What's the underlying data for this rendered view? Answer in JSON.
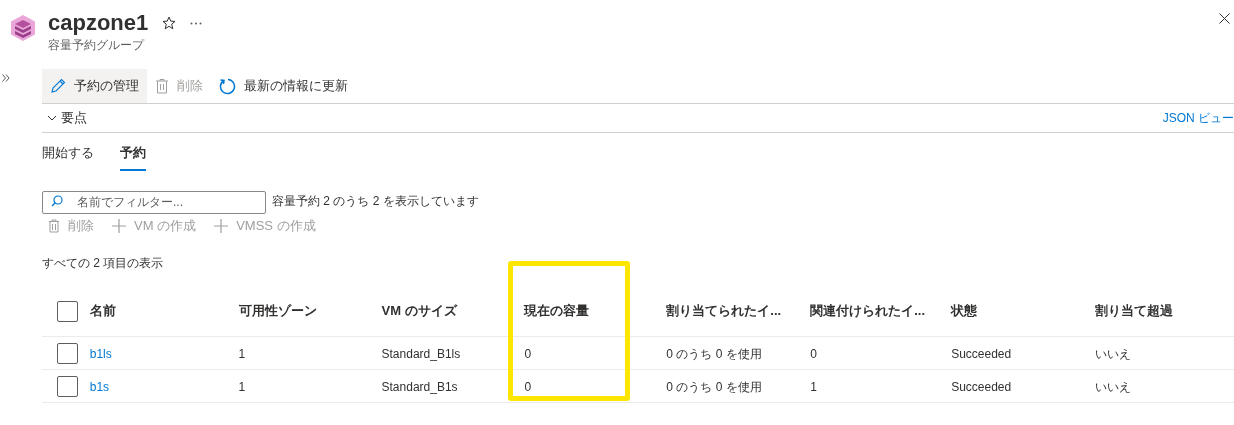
{
  "header": {
    "title": "capzone1",
    "subtitle": "容量予約グループ",
    "favorite": false
  },
  "toolbar": [
    {
      "kind": "edit",
      "label": "予約の管理",
      "disabled": false,
      "selected": true
    },
    {
      "kind": "delete",
      "label": "削除",
      "disabled": true,
      "selected": false
    },
    {
      "kind": "refresh",
      "label": "最新の情報に更新",
      "disabled": false,
      "selected": false
    }
  ],
  "essentials": {
    "label": "要点",
    "expanded": false,
    "json_link": "JSON ビュー"
  },
  "tabs": [
    {
      "label": "開始する",
      "selected": false
    },
    {
      "label": "予約",
      "selected": true
    }
  ],
  "filter": {
    "placeholder": "名前でフィルター...",
    "summary": "容量予約 2 のうち 2 を表示しています"
  },
  "actions": [
    {
      "kind": "delete",
      "label": "削除",
      "disabled": true
    },
    {
      "kind": "add",
      "label": "VM の作成",
      "disabled": true
    },
    {
      "kind": "add",
      "label": "VMSS の作成",
      "disabled": true
    }
  ],
  "count_label": "すべての 2 項目の表示",
  "table": {
    "columns": [
      {
        "label": "名前",
        "highlighted": false
      },
      {
        "label": "可用性ゾーン",
        "highlighted": false
      },
      {
        "label": "VM のサイズ",
        "highlighted": false
      },
      {
        "label": "現在の容量",
        "highlighted": true
      },
      {
        "label": "割り当てられたイ...",
        "highlighted": false
      },
      {
        "label": "関連付けられたイ...",
        "highlighted": false
      },
      {
        "label": "状態",
        "highlighted": false
      },
      {
        "label": "割り当て超過",
        "highlighted": false
      }
    ],
    "all_checked": false,
    "rows": [
      {
        "checked": false,
        "cells": [
          "b1ls",
          "1",
          "Standard_B1ls",
          "0",
          "0 のうち 0 を使用",
          "0",
          "Succeeded",
          "いいえ"
        ]
      },
      {
        "checked": false,
        "cells": [
          "b1s",
          "1",
          "Standard_B1s",
          "0",
          "0 のうち 0 を使用",
          "1",
          "Succeeded",
          "いいえ"
        ]
      }
    ]
  }
}
